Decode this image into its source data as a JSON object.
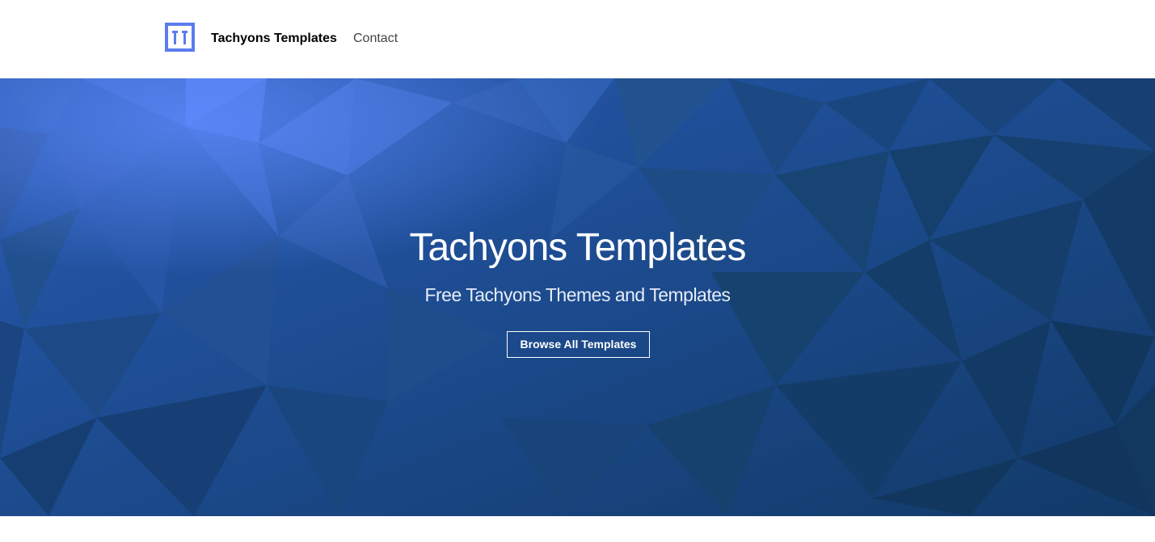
{
  "header": {
    "logo_icon": "tachyons-logo-icon",
    "brand_name": "Tachyons Templates",
    "nav_links": [
      "Contact"
    ]
  },
  "hero": {
    "title": "Tachyons Templates",
    "subtitle": "Free Tachyons Themes and Templates",
    "cta_label": "Browse All Templates",
    "background": "low-poly-blue-pattern"
  },
  "colors": {
    "accent": "#5a7cf0",
    "hero_base": "#1a4a86",
    "hero_dark": "#133d6e",
    "hero_light": "#4a72d8",
    "text_dark": "#000000",
    "nav_text": "#444444",
    "white": "#ffffff"
  }
}
